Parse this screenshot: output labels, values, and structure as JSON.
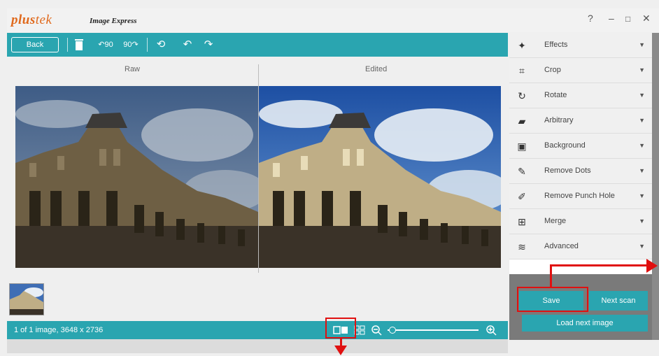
{
  "app": {
    "brand": "plus",
    "brand_tail": "tek",
    "subtitle": "Image Express",
    "help": "?",
    "minimize": "–",
    "maximize": "□",
    "close": "✕"
  },
  "toolbar": {
    "back_label": "Back",
    "icons": [
      "delete-icon",
      "rotate-left-90-icon",
      "rotate-right-90-icon",
      "flip-icon",
      "undo-icon",
      "redo-icon"
    ],
    "rotate_left_text": "90",
    "rotate_right_text": "90"
  },
  "viewer": {
    "raw_label": "Raw",
    "edited_label": "Edited"
  },
  "status": {
    "text": "1 of 1 image, 3648 x 2736",
    "zoom_level_fraction": 0.05
  },
  "panel": {
    "items": [
      {
        "label": "Effects",
        "icon": "effects-icon",
        "glyph": "✦"
      },
      {
        "label": "Crop",
        "icon": "crop-icon",
        "glyph": "⌗"
      },
      {
        "label": "Rotate",
        "icon": "rotate-icon",
        "glyph": "↻"
      },
      {
        "label": "Arbitrary",
        "icon": "arbitrary-icon",
        "glyph": "▰"
      },
      {
        "label": "Background",
        "icon": "background-icon",
        "glyph": "▣"
      },
      {
        "label": "Remove Dots",
        "icon": "remove-dots-icon",
        "glyph": "✎"
      },
      {
        "label": "Remove Punch Hole",
        "icon": "remove-punch-hole-icon",
        "glyph": "✐"
      },
      {
        "label": "Merge",
        "icon": "merge-icon",
        "glyph": "⊞"
      },
      {
        "label": "Advanced",
        "icon": "advanced-icon",
        "glyph": "≋"
      }
    ],
    "save_label": "Save",
    "next_scan_label": "Next scan",
    "load_next_label": "Load next image"
  },
  "colors": {
    "accent": "#2aa5b0",
    "brand": "#e0691c",
    "highlight": "#e01010"
  }
}
